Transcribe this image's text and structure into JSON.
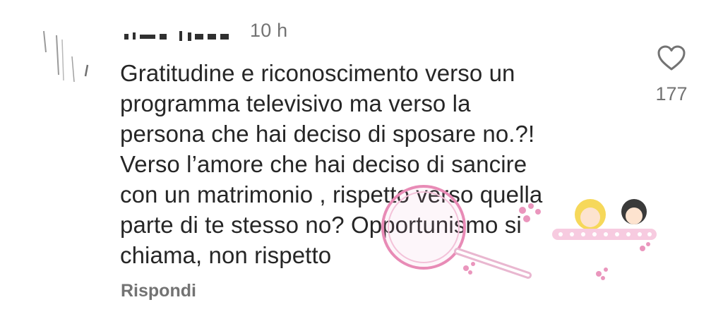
{
  "comment": {
    "timestamp": "10 h",
    "text": "Gratitudine e riconoscimento verso un\nprogramma televisivo ma verso la\npersona che hai deciso di sposare no.?!\nVerso l’amore che hai deciso di sancire\ncon un matrimonio , rispetto verso quella\nparte di te stesso no? Opportunismo si\nchiama, non rispetto",
    "reply_label": "Rispondi",
    "like_count": "177"
  },
  "icons": {
    "like": "heart-outline-icon",
    "avatar": "user-avatar",
    "watermark": "blog-watermark"
  },
  "colors": {
    "text": "#262626",
    "secondary": "#737373",
    "watermark_pink": "#e88bb6",
    "background": "#ffffff"
  }
}
